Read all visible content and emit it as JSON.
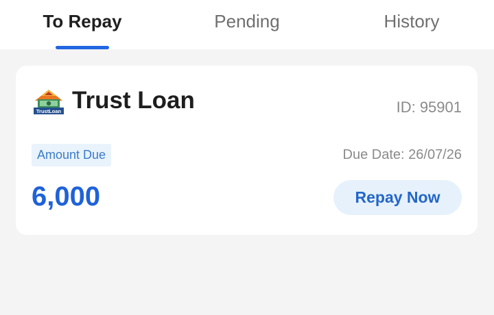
{
  "tabs": [
    {
      "label": "To Repay",
      "active": true
    },
    {
      "label": "Pending",
      "active": false
    },
    {
      "label": "History",
      "active": false
    }
  ],
  "card": {
    "logo_text": "TrustLoan",
    "logo_icon": "trust-loan-logo",
    "title": "Trust Loan",
    "id_text": "ID: 95901",
    "amount_label": "Amount Due",
    "due_date_text": "Due Date: 26/07/26",
    "amount_value": "6,000",
    "repay_label": "Repay Now"
  },
  "colors": {
    "accent": "#1f62d9",
    "badge_bg": "#e9f3fc",
    "button_bg": "#e6f1fb",
    "page_bg": "#f4f4f4"
  }
}
